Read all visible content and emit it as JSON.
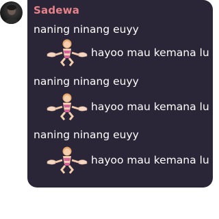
{
  "message": {
    "sender": "Sadewa",
    "avatar_icon": "profile-avatar-icon",
    "bubble_color": "#2a2638",
    "sender_color": "#e8828a",
    "blocks": [
      {
        "text": "naning ninang euyy",
        "emoji": "dancing-figure-emoji",
        "dance_text": "hayoo mau kemana lu"
      },
      {
        "text": "naning ninang euyy",
        "emoji": "dancing-figure-emoji",
        "dance_text": "hayoo mau kemana lu"
      },
      {
        "text": "naning ninang euyy",
        "emoji": "dancing-figure-emoji",
        "dance_text": "hayoo mau kemana lu"
      }
    ]
  }
}
